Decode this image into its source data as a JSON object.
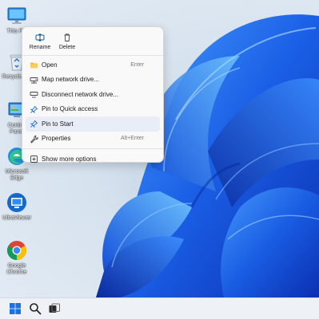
{
  "desktop": {
    "icons": [
      {
        "label": "This PC",
        "icon": "monitor-icon"
      },
      {
        "label": "Recycle Bin",
        "icon": "recycle-bin-icon"
      },
      {
        "label": "Control Panel",
        "icon": "control-panel-icon"
      },
      {
        "label": "Microsoft Edge",
        "icon": "edge-icon"
      },
      {
        "label": "UltraViewer",
        "icon": "ultraviewer-icon"
      },
      {
        "label": "Google Chrome",
        "icon": "chrome-icon"
      }
    ]
  },
  "context_menu": {
    "top_actions": [
      {
        "label": "Rename",
        "icon": "rename-icon"
      },
      {
        "label": "Delete",
        "icon": "trash-icon"
      }
    ],
    "items": [
      {
        "label": "Open",
        "shortcut": "Enter",
        "icon": "folder-icon"
      },
      {
        "label": "Map network drive...",
        "shortcut": "",
        "icon": "network-drive-icon"
      },
      {
        "label": "Disconnect network drive...",
        "shortcut": "",
        "icon": "disconnect-drive-icon"
      },
      {
        "label": "Pin to Quick access",
        "shortcut": "",
        "icon": "pin-icon"
      },
      {
        "label": "Pin to Start",
        "shortcut": "",
        "icon": "pin-icon",
        "highlighted": true
      },
      {
        "label": "Properties",
        "shortcut": "Alt+Enter",
        "icon": "wrench-icon"
      },
      {
        "label": "Show more options",
        "shortcut": "",
        "icon": "more-options-icon"
      }
    ]
  },
  "taskbar": {
    "items": [
      {
        "icon": "windows-start-icon"
      },
      {
        "icon": "search-icon"
      },
      {
        "icon": "task-view-icon"
      }
    ]
  },
  "colors": {
    "accent": "#0067c0",
    "bloom": "#1c6ef2",
    "menu_bg": "#f9f9f9",
    "taskbar_bg": "#eef2f7"
  }
}
